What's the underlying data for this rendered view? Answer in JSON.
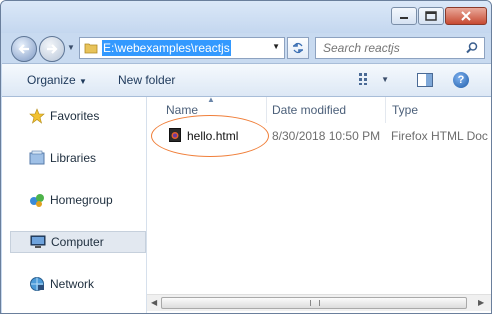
{
  "window": {
    "title": ""
  },
  "address": {
    "path": "E:\\webexamples\\reactjs"
  },
  "search": {
    "placeholder": "Search reactjs"
  },
  "toolbar": {
    "organize_label": "Organize",
    "new_folder_label": "New folder",
    "help_label": "?"
  },
  "sidebar": {
    "items": [
      {
        "label": "Favorites",
        "icon": "star-icon"
      },
      {
        "label": "Libraries",
        "icon": "library-icon"
      },
      {
        "label": "Homegroup",
        "icon": "homegroup-icon"
      },
      {
        "label": "Computer",
        "icon": "computer-icon",
        "selected": true
      },
      {
        "label": "Network",
        "icon": "network-icon"
      }
    ]
  },
  "file_list": {
    "columns": [
      "Name",
      "Date modified",
      "Type"
    ],
    "rows": [
      {
        "name": "hello.html",
        "date": "8/30/2018 10:50 PM",
        "type": "Firefox HTML Doc"
      }
    ]
  },
  "colors": {
    "highlight_ellipse": "#f07f3a",
    "address_selection": "#3399ff"
  }
}
